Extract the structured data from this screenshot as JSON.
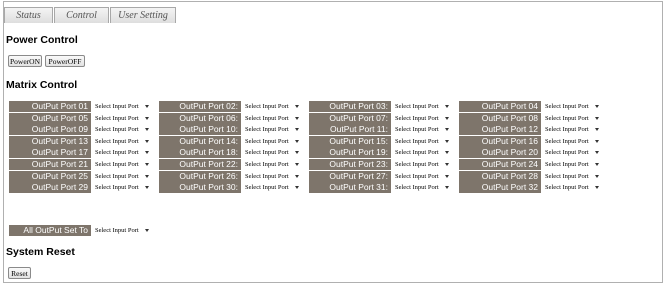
{
  "tabs": [
    "Status",
    "Control",
    "User Setting"
  ],
  "power": {
    "heading": "Power Control",
    "on_label": "PowerON",
    "off_label": "PowerOFF"
  },
  "matrix": {
    "heading": "Matrix Control",
    "select_placeholder": "Select Input Port",
    "ports": [
      "OutPut Port 01",
      "OutPut Port 02:",
      "OutPut Port 03:",
      "OutPut Port 04",
      "OutPut Port 05",
      "OutPut Port 06:",
      "OutPut Port 07:",
      "OutPut Port 08",
      "OutPut Port 09",
      "OutPut Port 10:",
      "OutPut Port 11:",
      "OutPut Port 12",
      "OutPut Port 13",
      "OutPut Port 14:",
      "OutPut Port 15:",
      "OutPut Port 16",
      "OutPut Port 17",
      "OutPut Port 18:",
      "OutPut Port 19:",
      "OutPut Port 20",
      "OutPut Port 21",
      "OutPut Port 22:",
      "OutPut Port 23:",
      "OutPut Port 24",
      "OutPut Port 25",
      "OutPut Port 26:",
      "OutPut Port 27:",
      "OutPut Port 28",
      "OutPut Port 29",
      "OutPut Port 30:",
      "OutPut Port 31:",
      "OutPut Port 32"
    ],
    "all_label": "All OutPut Set To"
  },
  "reset": {
    "heading": "System Reset",
    "button_label": "Reset"
  },
  "colors": {
    "label_bg": "#7e756b",
    "label_text": "#ffffff"
  },
  "icons": {
    "dropdown": "chevron-down-icon"
  }
}
